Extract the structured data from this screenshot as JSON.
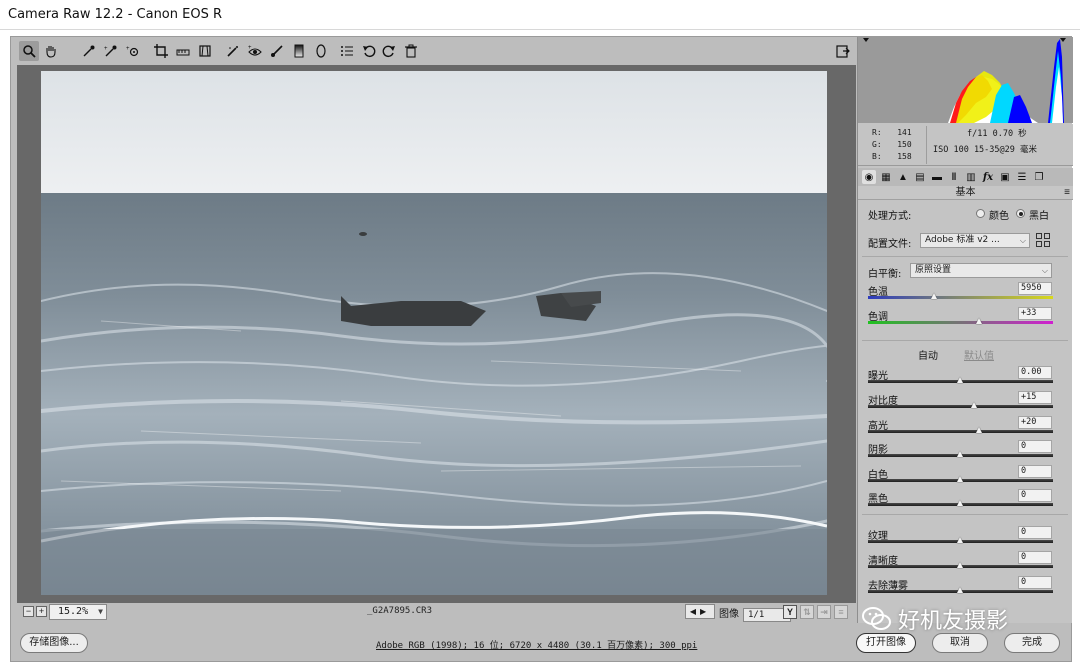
{
  "window": {
    "title": "Camera Raw 12.2 -  Canon EOS R"
  },
  "toolbar": {
    "tools": [
      {
        "name": "zoom-tool",
        "glyph": "🔍",
        "active": true
      },
      {
        "name": "hand-tool",
        "glyph": "✋",
        "active": false
      },
      {
        "name": "white-balance-tool",
        "glyph": "⁄",
        "active": false
      },
      {
        "name": "color-sampler-tool",
        "glyph": "⁄",
        "active": false
      },
      {
        "name": "targeted-adjustment-tool",
        "glyph": "⊙",
        "active": false
      },
      {
        "name": "crop-tool",
        "glyph": "⌗",
        "active": false
      },
      {
        "name": "straighten-tool",
        "glyph": "⊟",
        "active": false
      },
      {
        "name": "transform-tool",
        "glyph": "⧠",
        "active": false
      },
      {
        "name": "spot-removal-tool",
        "glyph": "⁄",
        "active": false
      },
      {
        "name": "red-eye-tool",
        "glyph": "⊕",
        "active": false
      },
      {
        "name": "adjustment-brush-tool",
        "glyph": "/",
        "active": false
      },
      {
        "name": "graduated-filter-tool",
        "glyph": "▮",
        "active": false
      },
      {
        "name": "radial-filter-tool",
        "glyph": "○",
        "active": false
      },
      {
        "name": "preferences-tool",
        "glyph": "☰",
        "active": false
      },
      {
        "name": "rotate-left-tool",
        "glyph": "↺",
        "active": false
      },
      {
        "name": "rotate-right-tool",
        "glyph": "↻",
        "active": false
      },
      {
        "name": "trash-tool",
        "glyph": "🗑",
        "active": false
      }
    ],
    "fullscreen_glyph": "⇱"
  },
  "preview": {
    "zoom": "15.2%",
    "filename": "_G2A7895.CR3",
    "image_label": "图像",
    "image_count": "1/1"
  },
  "info": {
    "r_label": "R:",
    "r_value": "141",
    "g_label": "G:",
    "g_value": "150",
    "b_label": "B:",
    "b_value": "158",
    "exif_line1": "f/11  0.70 秒",
    "exif_line2": "ISO 100  15-35@29 毫米"
  },
  "panel": {
    "section_title": "基本",
    "treatment_label": "处理方式:",
    "treatment_color": "颜色",
    "treatment_bw": "黑白",
    "profile_label": "配置文件:",
    "profile_value": "Adobe 标准 v2 ...",
    "wb_label": "白平衡:",
    "wb_value": "原照设置",
    "auto_label": "自动",
    "default_label": "默认值",
    "sliders": [
      {
        "key": "temp",
        "label": "色温",
        "value": "5950",
        "position": 0.36
      },
      {
        "key": "tint",
        "label": "色调",
        "value": "+33",
        "position": 0.6
      },
      {
        "key": "exposure",
        "label": "曝光",
        "value": "0.00",
        "position": 0.5
      },
      {
        "key": "contrast",
        "label": "对比度",
        "value": "+15",
        "position": 0.575
      },
      {
        "key": "highlights",
        "label": "高光",
        "value": "+20",
        "position": 0.6
      },
      {
        "key": "shadows",
        "label": "阴影",
        "value": "0",
        "position": 0.5
      },
      {
        "key": "whites",
        "label": "白色",
        "value": "0",
        "position": 0.5
      },
      {
        "key": "blacks",
        "label": "黑色",
        "value": "0",
        "position": 0.5
      },
      {
        "key": "texture",
        "label": "纹理",
        "value": "0",
        "position": 0.5
      },
      {
        "key": "clarity",
        "label": "清晰度",
        "value": "0",
        "position": 0.5
      },
      {
        "key": "dehaze",
        "label": "去除薄雾",
        "value": "0",
        "position": 0.5
      }
    ]
  },
  "footer": {
    "save_label": "存储图像...",
    "workflow_link": "Adobe RGB (1998); 16 位; 6720 x 4480 (30.1 百万像素); 300 ppi",
    "open_label": "打开图像",
    "cancel_label": "取消",
    "done_label": "完成"
  },
  "watermark": {
    "text": "好机友摄影"
  },
  "colors": {
    "panel_bg": "#c4c4c4",
    "workspace_bg": "#bdbdbd",
    "preview_bg": "#686868",
    "temp_gradient": [
      "#2d3bbd",
      "#d8d81c"
    ],
    "tint_gradient": [
      "#1fc21f",
      "#d01fd0"
    ]
  }
}
